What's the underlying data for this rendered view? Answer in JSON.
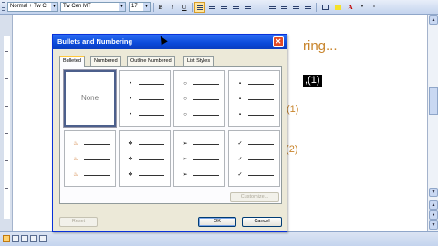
{
  "toolbar": {
    "style": "Normal + Tw C",
    "font": "Tw Cen MT",
    "size": "17",
    "bold": "B",
    "italic": "I",
    "underline": "U",
    "underline_color": "A"
  },
  "document": {
    "heading": "ring...",
    "highlight": ",(1)",
    "line1": "(1)",
    "line2": ",(2)",
    "line3": ".",
    "line4": "."
  },
  "dialog": {
    "title": "Bullets and Numbering",
    "close": "✕",
    "tabs": [
      "Bulleted",
      "Numbered",
      "Outline Numbered",
      "List Styles"
    ],
    "none_label": "None",
    "customize": "Customize...",
    "reset": "Reset",
    "ok": "OK",
    "cancel": "Cancel",
    "bullet_styles": [
      "•",
      "○",
      "▪",
      "♨",
      "❖",
      "➢",
      "✓"
    ]
  },
  "colors": {
    "doc_text": "#c8842b",
    "title_bar": "#0a49d9",
    "tab_accent": "#ffc83c"
  }
}
